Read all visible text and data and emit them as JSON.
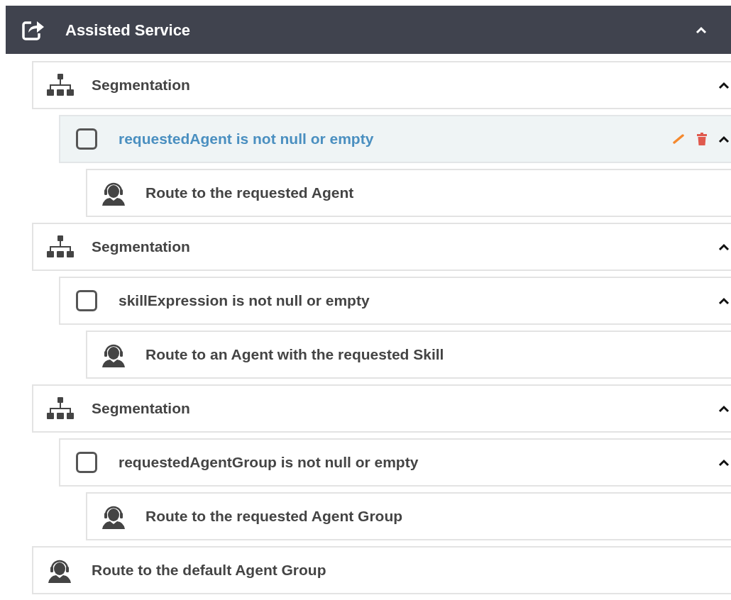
{
  "header": {
    "title": "Assisted Service",
    "expanded": true
  },
  "items": [
    {
      "kind": "segmentation",
      "label": "Segmentation",
      "expanded": true,
      "children": [
        {
          "kind": "condition",
          "label": "requestedAgent is not null or empty",
          "checked": false,
          "selected": true,
          "expanded": true,
          "children": [
            {
              "kind": "route",
              "label": "Route to the requested Agent"
            }
          ]
        }
      ]
    },
    {
      "kind": "segmentation",
      "label": "Segmentation",
      "expanded": true,
      "children": [
        {
          "kind": "condition",
          "label": "skillExpression is not null or empty",
          "checked": false,
          "selected": false,
          "expanded": true,
          "children": [
            {
              "kind": "route",
              "label": "Route to an Agent with the requested Skill"
            }
          ]
        }
      ]
    },
    {
      "kind": "segmentation",
      "label": "Segmentation",
      "expanded": true,
      "children": [
        {
          "kind": "condition",
          "label": "requestedAgentGroup is not null or empty",
          "checked": false,
          "selected": false,
          "expanded": true,
          "children": [
            {
              "kind": "route",
              "label": "Route to the requested Agent Group"
            }
          ]
        }
      ]
    },
    {
      "kind": "route",
      "label": "Route to the default Agent Group"
    }
  ]
}
